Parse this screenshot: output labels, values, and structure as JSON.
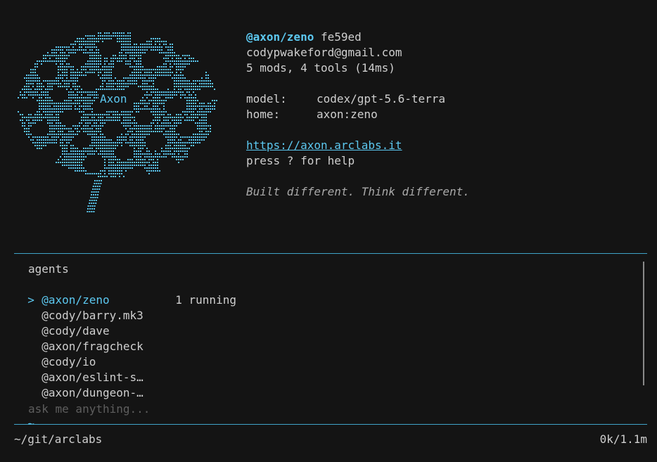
{
  "banner": {
    "art_label": "Axon",
    "art_color": "#5cc8f0",
    "handle": "@axon/zeno",
    "commit": "fe59ed",
    "email": "codypwakeford@gmail.com",
    "stats": "5 mods, 4 tools (14ms)",
    "model_label": "model:",
    "model_value": "codex/gpt-5.6-terra",
    "home_label": "home:",
    "home_value": "axon:zeno",
    "url": "https://axon.arclabs.it",
    "help": "press ? for help",
    "tagline": "Built different. Think different."
  },
  "agents": {
    "header": "agents",
    "cursor": ">",
    "items": [
      {
        "name": "@axon/zeno",
        "status": "1 running",
        "selected": true
      },
      {
        "name": "@cody/barry.mk3",
        "status": ""
      },
      {
        "name": "@cody/dave",
        "status": ""
      },
      {
        "name": "@axon/fragcheck",
        "status": ""
      },
      {
        "name": "@cody/io",
        "status": ""
      },
      {
        "name": "@axon/eslint-s…",
        "status": ""
      },
      {
        "name": "@axon/dungeon-…",
        "status": ""
      }
    ]
  },
  "prompt": {
    "symbol": "~",
    "placeholder": "ask me anything..."
  },
  "status_bar": {
    "cwd": "~/git/arclabs",
    "context": "0k/1.1m"
  },
  "colors": {
    "accent": "#5cc8f0",
    "background": "#141414",
    "text": "#cfcfcf",
    "divider": "#3fa3c8"
  }
}
